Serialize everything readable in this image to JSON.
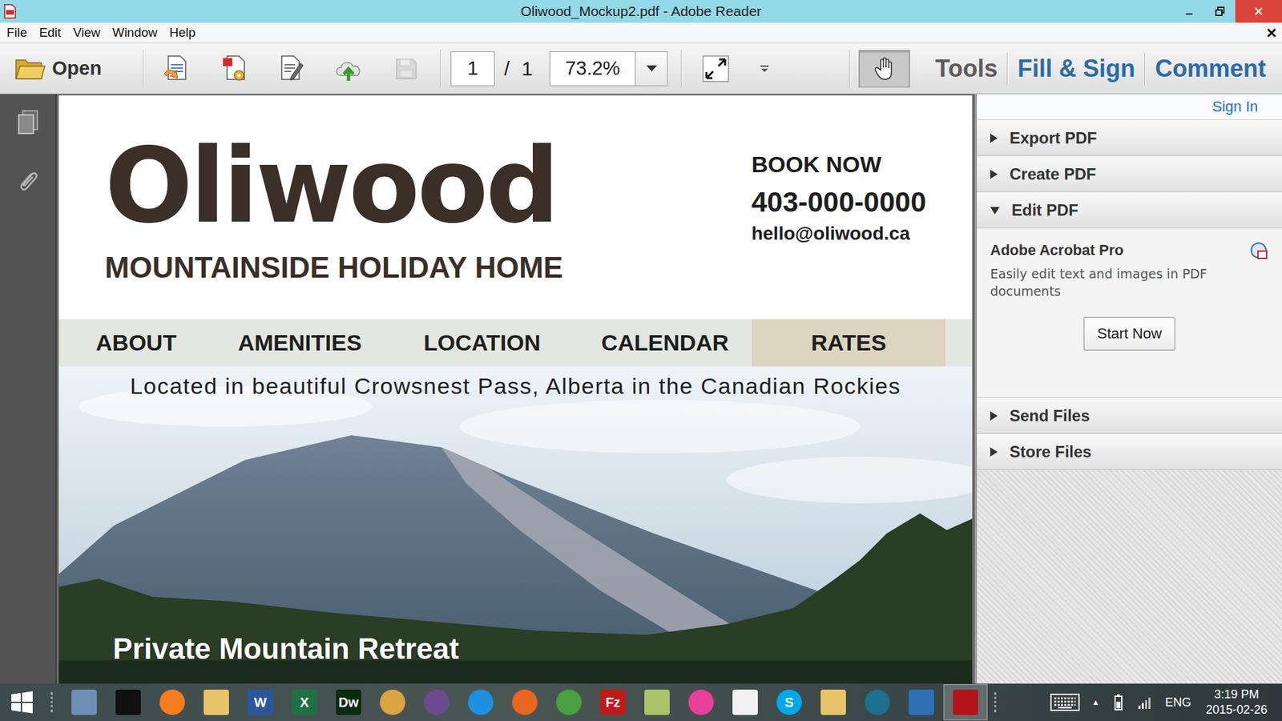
{
  "window": {
    "title": "Oliwood_Mockup2.pdf - Adobe Reader"
  },
  "menu": {
    "items": [
      "File",
      "Edit",
      "View",
      "Window",
      "Help"
    ],
    "close": "×"
  },
  "toolbar": {
    "open": "Open",
    "buttons": [
      {
        "kind": "create",
        "disabled": false
      },
      {
        "kind": "pdf",
        "disabled": false
      },
      {
        "kind": "edit",
        "disabled": false
      },
      {
        "kind": "upload",
        "disabled": false
      },
      {
        "kind": "save",
        "disabled": true
      }
    ],
    "page": {
      "current": "1",
      "separator": "/",
      "total": "1"
    },
    "zoom": "73.2%",
    "hand_tool": {
      "selected": true
    },
    "links": [
      {
        "label": "Tools",
        "color": "#5b5b5b"
      },
      {
        "label": "Fill & Sign",
        "color": "#2d6ca2"
      },
      {
        "label": "Comment",
        "color": "#2d6ca2"
      }
    ]
  },
  "document": {
    "logo": "Oliwood",
    "tagline": "MOUNTAINSIDE HOLIDAY HOME",
    "book": {
      "heading": "BOOK NOW",
      "phone": "403-000-0000",
      "email": "hello@oliwood.ca"
    },
    "nav": [
      {
        "label": "ABOUT",
        "selected": false
      },
      {
        "label": "AMENITIES",
        "selected": false
      },
      {
        "label": "LOCATION",
        "selected": false
      },
      {
        "label": "CALENDAR",
        "selected": false
      },
      {
        "label": "RATES",
        "selected": true
      }
    ],
    "hero": {
      "caption": "Located in beautiful Crowsnest Pass, Alberta in the Canadian Rockies",
      "title": "Private Mountain Retreat"
    }
  },
  "panel": {
    "sign_in": "Sign In",
    "sections": [
      {
        "label": "Export PDF",
        "expanded": false
      },
      {
        "label": "Create PDF",
        "expanded": false
      },
      {
        "label": "Edit PDF",
        "expanded": true
      },
      {
        "label": "Send Files",
        "expanded": false
      },
      {
        "label": "Store Files",
        "expanded": false
      }
    ],
    "promo": {
      "title": "Adobe Acrobat Pro",
      "text": "Easily edit text and images in PDF documents",
      "button": "Start Now"
    }
  },
  "taskbar": {
    "apps": [
      {
        "kind": "tile",
        "color": "#6d8fb5",
        "selected": false
      },
      {
        "kind": "tile",
        "color": "#101010",
        "selected": false
      },
      {
        "kind": "circle",
        "color": "#f57c1f",
        "selected": false
      },
      {
        "kind": "tile",
        "color": "#e9c46a",
        "selected": false
      },
      {
        "kind": "tile",
        "color": "#2b579a",
        "glyph": "W",
        "selected": false
      },
      {
        "kind": "tile",
        "color": "#1e7145",
        "glyph": "X",
        "selected": false
      },
      {
        "kind": "tile",
        "color": "#0c2a10",
        "glyph": "Dw",
        "selected": false
      },
      {
        "kind": "circle",
        "color": "#d9a441",
        "selected": false
      },
      {
        "kind": "circle",
        "color": "#6e4a8e",
        "selected": false
      },
      {
        "kind": "circle",
        "color": "#1f8fe0",
        "selected": false
      },
      {
        "kind": "circle",
        "color": "#e8661f",
        "selected": false
      },
      {
        "kind": "circle",
        "color": "#4aa03f",
        "selected": false
      },
      {
        "kind": "tile",
        "color": "#bf1b1b",
        "glyph": "Fz",
        "selected": false
      },
      {
        "kind": "tile",
        "color": "#a9c46a",
        "selected": false
      },
      {
        "kind": "circle",
        "color": "#e8409a",
        "selected": false
      },
      {
        "kind": "tile",
        "color": "#f1f1f1",
        "selected": false
      },
      {
        "kind": "circle",
        "color": "#00a8e8",
        "glyph": "S",
        "selected": false
      },
      {
        "kind": "tile",
        "color": "#e9c46a",
        "selected": false
      },
      {
        "kind": "circle",
        "color": "#1d6f8e",
        "selected": false
      },
      {
        "kind": "tile",
        "color": "#2e6fb5",
        "selected": false
      },
      {
        "kind": "tile",
        "color": "#b3131b",
        "selected": true
      }
    ],
    "tray": {
      "chevron": "▲",
      "language": "ENG",
      "time": "3:19 PM",
      "date": "2015-02-26"
    }
  }
}
